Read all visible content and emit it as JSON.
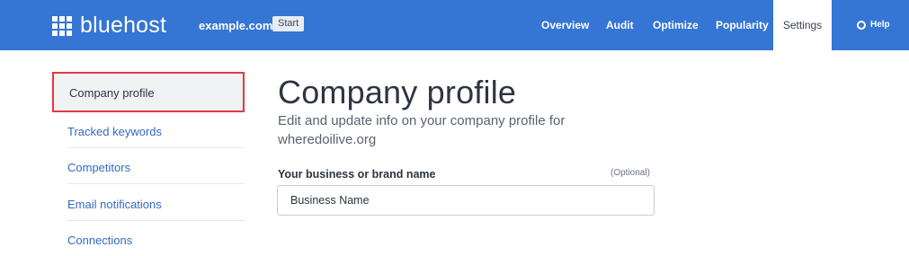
{
  "header": {
    "brand": "bluehost",
    "site": "example.com",
    "start_badge": "Start",
    "nav": [
      "Overview",
      "Audit",
      "Optimize",
      "Popularity"
    ],
    "active_nav": "Settings",
    "help": "Help",
    "bg_color": "#3575d3"
  },
  "sidebar": {
    "active": "Company profile",
    "items": [
      "Tracked keywords",
      "Competitors",
      "Email notifications",
      "Connections"
    ],
    "highlight_color": "#e4383e"
  },
  "main": {
    "title": "Company profile",
    "subtitle": "Edit and update info on your company profile for wheredoilive.org",
    "field_label": "Your business or brand name",
    "field_optional": "(Optional)",
    "field_placeholder": "Business Name"
  }
}
